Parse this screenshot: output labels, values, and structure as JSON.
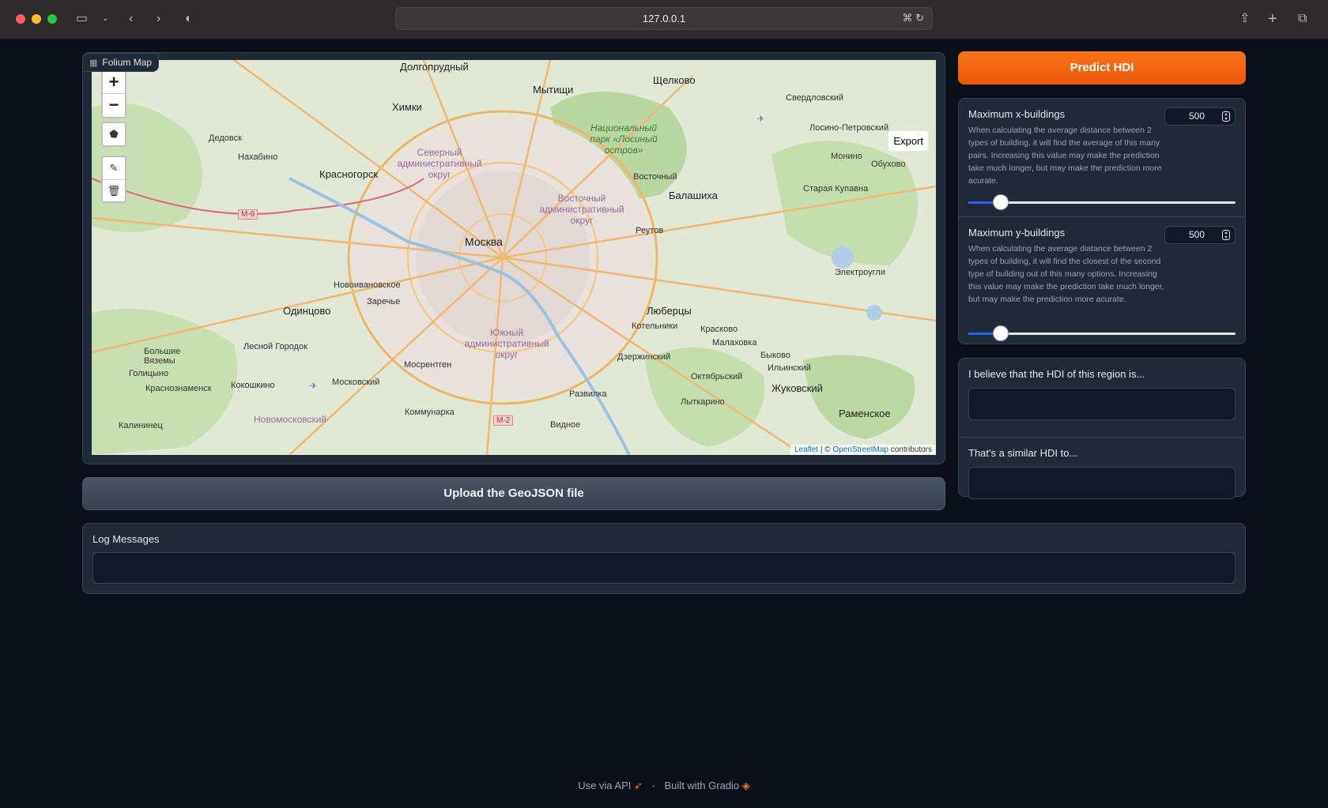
{
  "browser": {
    "url": "127.0.0.1"
  },
  "map": {
    "label": "Folium Map",
    "zoom_in": "+",
    "zoom_out": "−",
    "export_label": "Export",
    "attribution": {
      "leaflet": "Leaflet",
      "sep": " | © ",
      "osm": "OpenStreetMap",
      "contributors": " contributors"
    },
    "places": {
      "moscow": "Москва",
      "dolgoprudny": "Долгопрудный",
      "mytishchi": "Мытищи",
      "shchelkovo": "Щелково",
      "khimki": "Химки",
      "krasnogorsk": "Красногорск",
      "odintsovo": "Одинцово",
      "lyubertsy": "Люберцы",
      "balashikha": "Балашиха",
      "zhukovsky": "Жуковский",
      "ramenskoe": "Раменское",
      "dedovsk": "Дедовск",
      "nakhabino": "Нахабино",
      "vostochny": "Восточный",
      "reutov": "Реутов",
      "novoivanovskoe": "Новоивановское",
      "zarechye": "Заречье",
      "kotelniki": "Котельники",
      "kraskovo": "Красково",
      "malakhovka": "Малаховка",
      "dzerzhinsky": "Дзержинский",
      "mosrentgen": "Мосрентген",
      "lesnoy": "Лесной Городок",
      "kokoshkino": "Кокошкино",
      "moskovsky": "Московский",
      "razvilka": "Развилка",
      "kommunarka": "Коммунарка",
      "lytkarino": "Лыткарино",
      "oktyabrsky": "Октябрьский",
      "bykovo": "Быково",
      "ilyinsky": "Ильинский",
      "elektrougli": "Электроугли",
      "staraya_kupavna": "Старая Купавна",
      "monino": "Монино",
      "obukhovo": "Обухово",
      "losino": "Лосино-Петровский",
      "sverdlovsky": "Свердловский",
      "bolshie_vyazemy": "Большие Вяземы",
      "golitsyno": "Голицыно",
      "krasnoznamensk": "Краснознаменск",
      "kalininets": "Калининец",
      "vidnoe": "Видное",
      "novomoskovsky": "Новомосковский",
      "district_north": "Северный административный округ",
      "district_east": "Восточный административный округ",
      "district_south": "Южный административный округ",
      "losiny": "Национальный парк «Лосиный остров»",
      "m9": "M-9",
      "m2": "M-2"
    }
  },
  "upload_button": "Upload the GeoJSON file",
  "predict_button": "Predict HDI",
  "x_buildings": {
    "label": "Maximum x-buildings",
    "info": "When calculating the average distance between 2 types of building, it will find the average of this many pairs. Increasing this value may make the prediction take much longer, but may make the prediction more acurate.",
    "value": "500",
    "slider_fraction": 0.12
  },
  "y_buildings": {
    "label": "Maximum y-buildings",
    "info": "When calculating the average diatance between 2 types of building, it will find the closest of the second type of building out of this many options. Increasing this value may make the prediction take much longer, but may make the prediction more acurate.",
    "value": "500",
    "slider_fraction": 0.12
  },
  "hdi_output": {
    "label": "I believe that the HDI of this region is...",
    "value": ""
  },
  "similar_output": {
    "label": "That's a similar HDI to...",
    "value": ""
  },
  "log": {
    "label": "Log Messages",
    "value": ""
  },
  "footer": {
    "api": "Use via API",
    "sep": "·",
    "built": "Built with Gradio"
  }
}
